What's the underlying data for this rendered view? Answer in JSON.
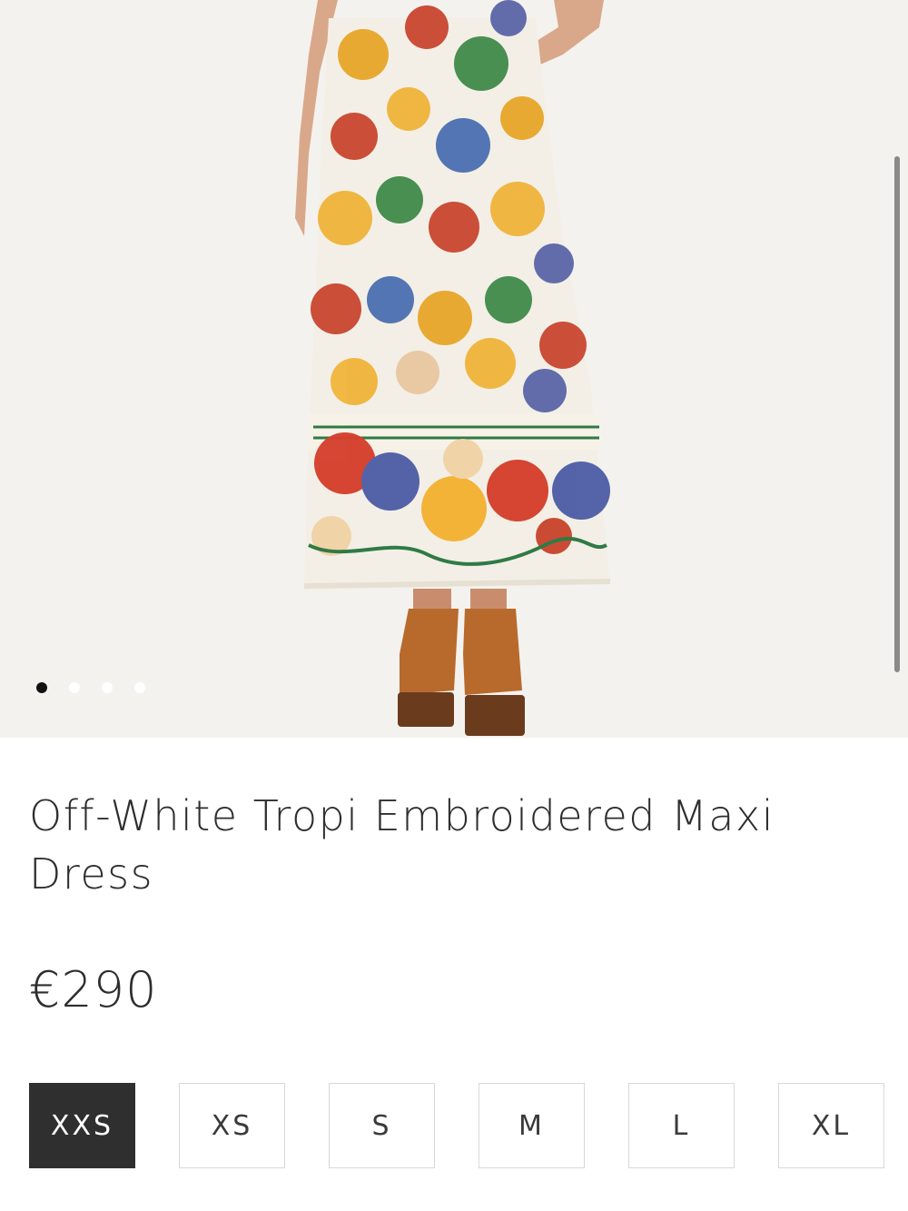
{
  "product": {
    "title": "Off-White Tropi Embroidered Maxi Dress",
    "price": "€290",
    "image_alt": "Model wearing off-white tropical floral maxi skirt with brown platform sandals"
  },
  "gallery": {
    "slide_count": 4,
    "active_slide": 1
  },
  "sizes": {
    "options": [
      "XXS",
      "XS",
      "S",
      "M",
      "L",
      "XL"
    ],
    "selected": "XXS"
  },
  "colors": {
    "background": "#ffffff",
    "photo_background": "#f4f2ee",
    "selected_size_bg": "#2f2f2f",
    "text": "#2e2e2e",
    "border": "#d8d8d8"
  }
}
